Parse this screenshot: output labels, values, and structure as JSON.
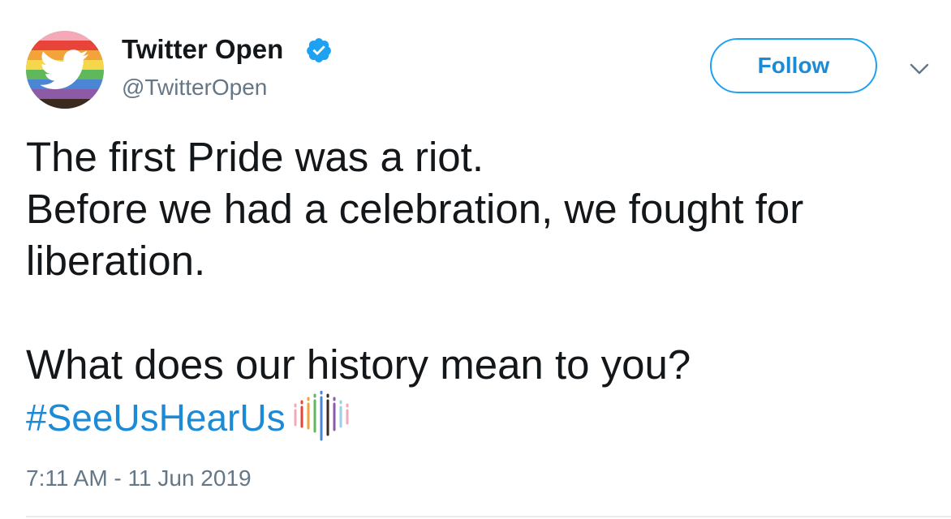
{
  "user": {
    "display_name": "Twitter Open",
    "handle": "@TwitterOpen",
    "verified": true,
    "avatar_icon": "twitter-bird-pride-avatar-icon"
  },
  "actions": {
    "follow_label": "Follow",
    "menu_icon": "chevron-down-icon"
  },
  "tweet": {
    "lines": [
      "The first Pride was a riot.",
      "Before we had a celebration, we fought for",
      "liberation.",
      "",
      "What does our history mean to you?"
    ],
    "hashtag": "#SeeUsHearUs",
    "hashtag_emoji": "pride-bars-emoji",
    "timestamp": "7:11 AM - 11 Jun 2019"
  },
  "colors": {
    "accent": "#1da1f2",
    "link": "#1d8ad6",
    "secondary_text": "#657786",
    "primary_text": "#14171a",
    "pride_stripes": [
      "#f4a9b8",
      "#e8443a",
      "#f2a33a",
      "#f6d64a",
      "#5fb85a",
      "#4a86d4",
      "#8d5aa8",
      "#3a2a1e"
    ]
  }
}
